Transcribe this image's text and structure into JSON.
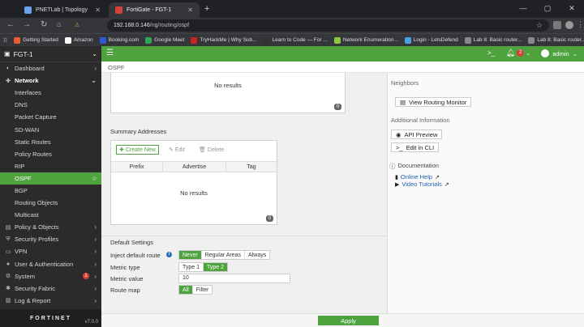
{
  "browser": {
    "tabs": [
      {
        "label": "PNETLab | Topology",
        "color": "#6aa1e8"
      },
      {
        "label": "FortiGate - FGT-1",
        "color": "#d9403a"
      }
    ],
    "new_tab": "+",
    "url_host": "192.168.0.146",
    "url_path": "/ng/routing/ospf",
    "security_label": "Not secure",
    "bookmarks": [
      {
        "label": "Getting Started",
        "color": "#e85d2f"
      },
      {
        "label": "Amazon",
        "color": "#ffffff"
      },
      {
        "label": "Booking.com",
        "color": "#2a5bd7"
      },
      {
        "label": "Google Meet",
        "color": "#2fa45a"
      },
      {
        "label": "TryHackMe | Why Sub...",
        "color": "#c22"
      },
      {
        "label": "Learn to Code — For ...",
        "color": "#333"
      },
      {
        "label": "Network Enumeration...",
        "color": "#8dc641"
      },
      {
        "label": "Login - LetsDefend",
        "color": "#4aa0e0"
      },
      {
        "label": "Lab 8: Basic router...",
        "color": "#888"
      },
      {
        "label": "Lab 8: Basic router...",
        "color": "#888"
      }
    ],
    "other_bookmarks": "Other Bookmarks"
  },
  "sidebar": {
    "device": "FGT-1",
    "items": [
      {
        "label": "Dashboard",
        "icon": "dashboard-icon",
        "glyph": "◐",
        "top": true,
        "chev": true
      },
      {
        "label": "Network",
        "icon": "network-icon",
        "glyph": "✚",
        "top": true,
        "open": true
      },
      {
        "label": "Interfaces"
      },
      {
        "label": "DNS"
      },
      {
        "label": "Packet Capture"
      },
      {
        "label": "SD-WAN"
      },
      {
        "label": "Static Routes"
      },
      {
        "label": "Policy Routes"
      },
      {
        "label": "RIP"
      },
      {
        "label": "OSPF",
        "active": true
      },
      {
        "label": "BGP"
      },
      {
        "label": "Routing Objects"
      },
      {
        "label": "Multicast"
      },
      {
        "label": "Policy & Objects",
        "icon": "policy-icon",
        "glyph": "▤",
        "top": true,
        "chev": true
      },
      {
        "label": "Security Profiles",
        "icon": "shield-icon",
        "glyph": "⛨",
        "top": true,
        "chev": true
      },
      {
        "label": "VPN",
        "icon": "vpn-icon",
        "glyph": "▭",
        "top": true,
        "chev": true
      },
      {
        "label": "User & Authentication",
        "icon": "user-icon",
        "glyph": "●",
        "top": true,
        "chev": true
      },
      {
        "label": "System",
        "icon": "gear-icon",
        "glyph": "⚙",
        "top": true,
        "chev": true,
        "badge": "1"
      },
      {
        "label": "Security Fabric",
        "icon": "fabric-icon",
        "glyph": "✱",
        "top": true,
        "chev": true
      },
      {
        "label": "Log & Report",
        "icon": "log-icon",
        "glyph": "▥",
        "top": true,
        "chev": true
      }
    ],
    "brand": "FORTINET",
    "version": "v7.0.0"
  },
  "header": {
    "cli_glyph": ">_",
    "notifications": "2",
    "user": "admin"
  },
  "page": {
    "breadcrumb": "OSPF",
    "top_table": {
      "empty_text": "No results",
      "count": "0"
    },
    "summary": {
      "title": "Summary Addresses",
      "create_label": "Create New",
      "edit_label": "Edit",
      "delete_label": "Delete",
      "columns": [
        "Prefix",
        "Advertise",
        "Tag"
      ],
      "empty_text": "No results",
      "count": "0"
    },
    "defaults": {
      "title": "Default Settings",
      "inject_label": "Inject default route",
      "inject_options": [
        "Never",
        "Regular Areas",
        "Always"
      ],
      "inject_selected": 0,
      "metric_type_label": "Metric type",
      "metric_type_options": [
        "Type 1",
        "Type 2"
      ],
      "metric_type_selected": 1,
      "metric_value_label": "Metric value",
      "metric_value": "10",
      "route_map_label": "Route map",
      "route_map_options": [
        "All",
        "Filter"
      ],
      "route_map_selected": 0
    },
    "apply_label": "Apply"
  },
  "right": {
    "neighbors_title": "Neighbors",
    "view_monitor": "View Routing Monitor",
    "additional_title": "Additional Information",
    "api_preview": "API Preview",
    "edit_cli": "Edit in CLI",
    "docs_title": "Documentation",
    "online_help": "Online Help",
    "video_tutorials": "Video Tutorials"
  },
  "colors": {
    "accent": "#4ea33f",
    "sidebar": "#2b2b2b",
    "badge": "#d9403a"
  }
}
